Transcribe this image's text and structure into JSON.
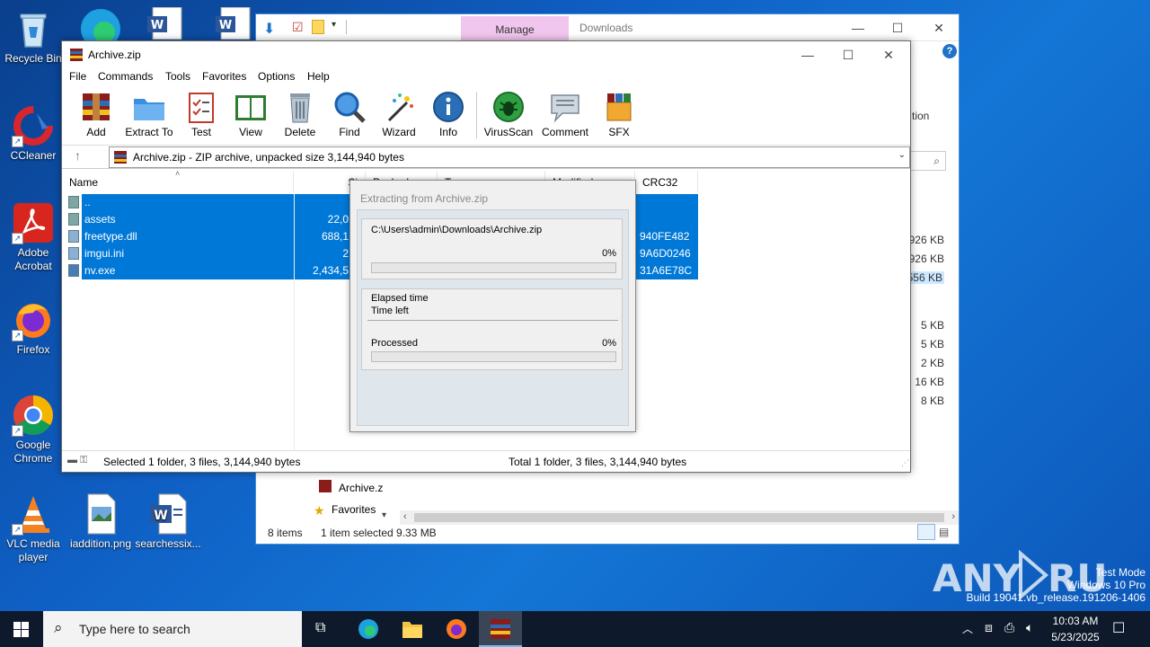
{
  "desktop": {
    "icons": [
      {
        "label": "Recycle Bin"
      },
      {
        "label": "CCleaner"
      },
      {
        "label": "Adobe Acrobat"
      },
      {
        "label": "Firefox"
      },
      {
        "label": "Google Chrome"
      },
      {
        "label": "VLC media player"
      },
      {
        "label": "iaddition.png"
      },
      {
        "label": "searchessix..."
      }
    ]
  },
  "explorer": {
    "manage_tab": "Manage",
    "title": "Downloads",
    "right_text": "tion",
    "sizes": [
      "926 KB",
      "926 KB",
      "556 KB",
      "5 KB",
      "5 KB",
      "2 KB",
      "16 KB",
      "8 KB"
    ],
    "nav_items": [
      "Archive.z",
      "Favorites"
    ],
    "status_items": "8 items",
    "status_selected": "1 item selected",
    "status_size": "9.33 MB"
  },
  "winrar": {
    "title": "Archive.zip",
    "menu": [
      "File",
      "Commands",
      "Tools",
      "Favorites",
      "Options",
      "Help"
    ],
    "toolbar": [
      "Add",
      "Extract To",
      "Test",
      "View",
      "Delete",
      "Find",
      "Wizard",
      "Info",
      "VirusScan",
      "Comment",
      "SFX"
    ],
    "address": "Archive.zip - ZIP archive, unpacked size 3,144,940 bytes",
    "columns": [
      "Name",
      "Si",
      "Packed",
      "T",
      "Modified",
      "CRC32"
    ],
    "rows": [
      {
        "name": "..",
        "size": "",
        "crc": ""
      },
      {
        "name": "assets",
        "size": "22,0",
        "crc": ""
      },
      {
        "name": "freetype.dll",
        "size": "688,1",
        "crc": "940FE482"
      },
      {
        "name": "imgui.ini",
        "size": "2",
        "crc": "9A6D0246"
      },
      {
        "name": "nv.exe",
        "size": "2,434,5",
        "crc": "31A6E78C"
      }
    ],
    "status_left": "Selected 1 folder, 3 files, 3,144,940 bytes",
    "status_right": "Total 1 folder, 3 files, 3,144,940 bytes"
  },
  "dialog": {
    "title": "Extracting from Archive.zip",
    "path": "C:\\Users\\admin\\Downloads\\Archive.zip",
    "file_percent": "0%",
    "elapsed_label": "Elapsed time",
    "timeleft_label": "Time left",
    "processed_label": "Processed",
    "processed_percent": "0%",
    "file_progress": 0,
    "processed_progress": 0
  },
  "taskbar": {
    "search_placeholder": "Type here to search",
    "time": "10:03 AM",
    "date": "5/23/2025"
  },
  "watermark": {
    "brand": "ANY RUN",
    "line1": "Test Mode",
    "line2": "Windows 10 Pro",
    "line3": "Build 19041.vb_release.191206-1406"
  }
}
